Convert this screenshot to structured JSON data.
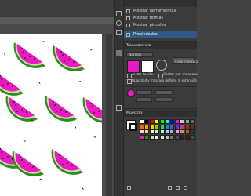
{
  "panel": {
    "menu": [
      {
        "label": "Mostrar herramientas"
      },
      {
        "label": "Mostrar formas"
      },
      {
        "label": "Mostrar pinceles"
      },
      {
        "label": "Propiedades"
      },
      {
        "label": "Transparencia"
      }
    ],
    "appearance": {
      "mode_label": "Normal",
      "clip_label": "Crear máscara",
      "option1": "Aislar fusión",
      "option2": "Cortar por máscara",
      "option3": "Opacidad y máscara definen la extensión"
    },
    "swatches_title": "Muestras"
  },
  "colors": {
    "accent": "#e919c3",
    "rind_green": "#2e8b1e",
    "rind_light": "#c8e2a0",
    "panel_bg": "#3b3b3b"
  },
  "swatches": [
    "#ffffff",
    "#000000",
    "#ff0000",
    "#ffff00",
    "#00ff00",
    "#00ffff",
    "#0000ff",
    "#ff00ff",
    "#c8c8c8",
    "#969696",
    "#646464",
    "#ff6600",
    "#ff9900",
    "#ffcc00",
    "#99cc00",
    "#33cc66",
    "#009999",
    "#3366cc",
    "#6633cc",
    "#cc3399",
    "#993300",
    "#663300",
    "#ffcccc",
    "#ffcc99",
    "#ffff99",
    "#ccff99",
    "#99ffcc",
    "#99ccff",
    "#cc99ff",
    "#ff99cc",
    "#cc9966",
    "#996633",
    "#333333",
    "#e919c3",
    "#2e8b1e",
    "#c8e2a0",
    "#f2f2f2",
    "#e0e0e0",
    "#bdbdbd",
    "#7a7a7a",
    "#4d4d4d",
    "#222222",
    "#800000",
    "#008000"
  ]
}
